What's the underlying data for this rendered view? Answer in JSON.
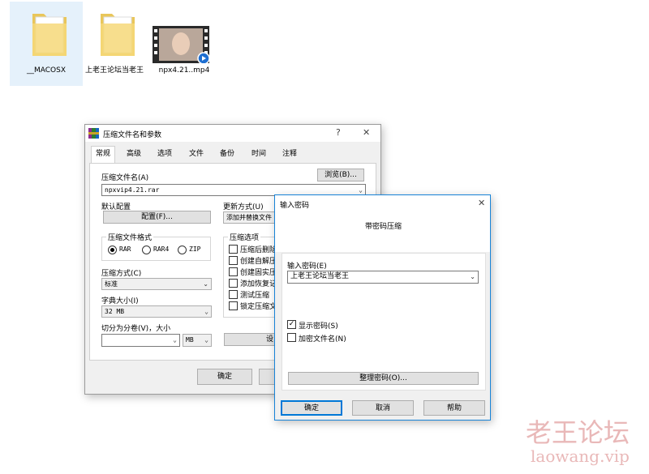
{
  "desktop": {
    "icons": [
      {
        "label": "__MACOSX"
      },
      {
        "label": "上老王论坛当老王"
      },
      {
        "label": "npx4.21..mp4"
      }
    ]
  },
  "archive_dialog": {
    "title": "压缩文件名和参数",
    "help_btn": "?",
    "close_btn": "✕",
    "tabs": [
      "常规",
      "高级",
      "选项",
      "文件",
      "备份",
      "时间",
      "注释"
    ],
    "archive_name_label": "压缩文件名(A)",
    "browse_btn": "浏览(B)...",
    "archive_name_value": "npxvip4.21.rar",
    "default_profile_label": "默认配置",
    "profiles_btn": "配置(F)...",
    "update_mode_label": "更新方式(U)",
    "update_mode_value": "添加并替换文件",
    "format_group": "压缩文件格式",
    "formats": [
      "RAR",
      "RAR4",
      "ZIP"
    ],
    "compression_method_label": "压缩方式(C)",
    "compression_method_value": "标准",
    "dictionary_label": "字典大小(I)",
    "dictionary_value": "32 MB",
    "split_label": "切分为分卷(V)，大小",
    "split_unit": "MB",
    "options_group": "压缩选项",
    "options": [
      "压缩后删除",
      "创建自解压",
      "创建固实压",
      "添加恢复记",
      "测试压缩",
      "锁定压缩文"
    ],
    "set_password_btn": "设",
    "ok_btn": "确定"
  },
  "password_dialog": {
    "title": "输入密码",
    "close_btn": "✕",
    "heading": "带密码压缩",
    "enter_password_label": "输入密码(E)",
    "password_value": "上老王论坛当老王",
    "show_password_label": "显示密码(S)",
    "encrypt_names_label": "加密文件名(N)",
    "organize_btn": "整理密码(O)...",
    "ok_btn": "确定",
    "cancel_btn": "取消",
    "help_btn": "帮助"
  },
  "watermark": {
    "line1": "老王论坛",
    "line2": "laowang.vip"
  }
}
